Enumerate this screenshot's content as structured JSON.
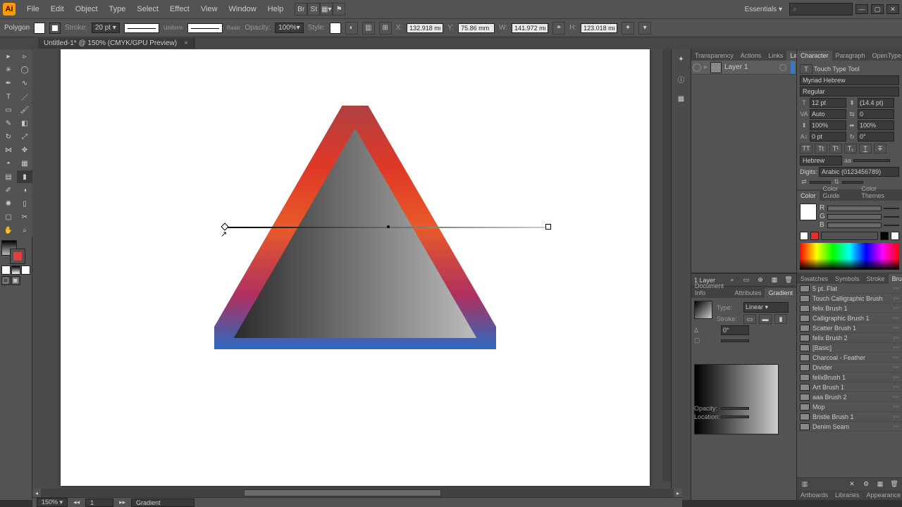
{
  "menubar": {
    "items": [
      "File",
      "Edit",
      "Object",
      "Type",
      "Select",
      "Effect",
      "View",
      "Window",
      "Help"
    ],
    "workspace": "Essentials"
  },
  "controlbar": {
    "shape_label": "Polygon",
    "stroke_label": "Stroke:",
    "stroke_weight": "20 pt",
    "stroke_profile": "Uniform",
    "brush_profile": "Basic",
    "opacity_label": "Opacity:",
    "opacity_value": "100%",
    "style_label": "Style:",
    "x_label": "X:",
    "x_value": "132.918 mm",
    "y_label": "Y:",
    "y_value": "75.86 mm",
    "w_label": "W:",
    "w_value": "141.972 mm",
    "h_label": "H:",
    "h_value": "123.018 mm"
  },
  "doc_tab": {
    "title": "Untitled-1* @ 150% (CMYK/GPU Preview)"
  },
  "status": {
    "zoom": "150%",
    "artboard_nav": "1",
    "tool_name": "Gradient"
  },
  "layers_panel": {
    "tabs": [
      "Transparency",
      "Actions",
      "Links",
      "Layers"
    ],
    "active_tab": 3,
    "rows": [
      {
        "name": "Layer 1"
      }
    ],
    "footer_label": "1 Layer"
  },
  "gradient_panel": {
    "tabs": [
      "Document Info",
      "Attributes",
      "Gradient"
    ],
    "active_tab": 2,
    "type_label": "Type:",
    "type_value": "Linear",
    "stroke_label": "Stroke:",
    "angle_label": "Δ",
    "angle_value": "0°",
    "opacity_label": "Opacity:",
    "opacity_value": "",
    "location_label": "Location:",
    "location_value": ""
  },
  "character_panel": {
    "tabs": [
      "Character",
      "Paragraph",
      "OpenType"
    ],
    "active_tab": 0,
    "tool_hint": "Touch Type Tool",
    "font_family": "Myriad Hebrew",
    "font_style": "Regular",
    "size": "12 pt",
    "leading": "(14.4 pt)",
    "vkern": "Auto",
    "tracking": "0",
    "vscale": "100%",
    "hscale": "100%",
    "baseline": "0 pt",
    "rotation": "0°",
    "language": "Hebrew",
    "digits_label": "Digits:",
    "digits_value": "Arabic (0123456789)"
  },
  "color_panel": {
    "tabs": [
      "Color",
      "Color Guide",
      "Color Themes"
    ],
    "active_tab": 0,
    "channels": [
      "R",
      "G",
      "B"
    ]
  },
  "brushes_panel": {
    "tabs": [
      "Swatches",
      "Symbols",
      "Stroke",
      "Brushes"
    ],
    "active_tab": 3,
    "items": [
      "5 pt. Flat",
      "Touch Calligraphic Brush",
      "felix Brush 1",
      "Calligraphic Brush 1",
      "Scatter Brush 1",
      "felix Brush 2",
      "[Basic]",
      "Charcoal - Feather",
      "Divider",
      "felixBrush 1",
      "Art Brush 1",
      "aaa Brush 2",
      "Mop",
      "Bristle Brush 1",
      "Denim Seam"
    ]
  },
  "bottom_tabs": {
    "tabs": [
      "Artboards",
      "Libraries",
      "Appearance"
    ]
  }
}
